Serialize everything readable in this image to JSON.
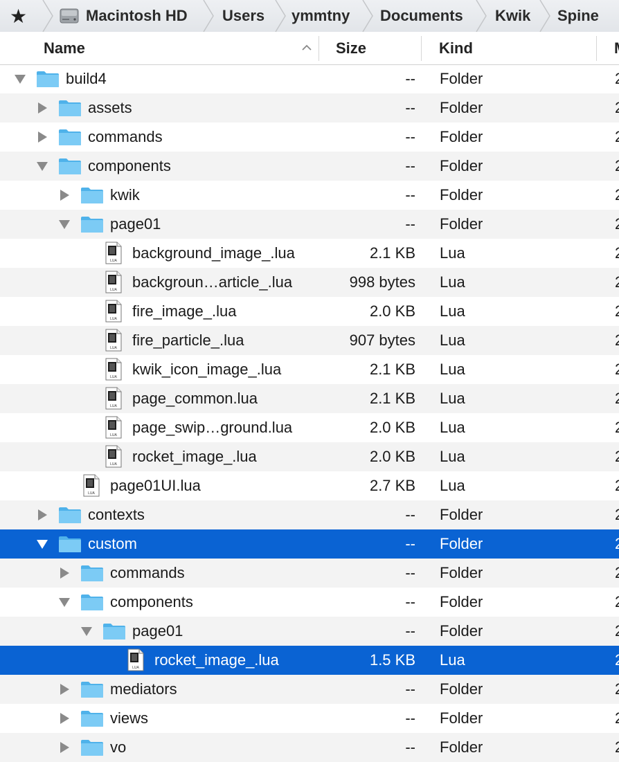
{
  "pathbar": {
    "star_label": "★",
    "crumbs": [
      "Macintosh HD",
      "Users",
      "ymmtny",
      "Documents",
      "Kwik",
      "Spine"
    ]
  },
  "header": {
    "name_label": "Name",
    "size_label": "Size",
    "kind_label": "Kind",
    "date_label": "M"
  },
  "rows": [
    {
      "name": "build4",
      "size": "--",
      "kind": "Folder",
      "date": "2",
      "type": "folder",
      "depth": 0,
      "disclosure": "open"
    },
    {
      "name": "assets",
      "size": "--",
      "kind": "Folder",
      "date": "2",
      "type": "folder",
      "depth": 1,
      "disclosure": "closed"
    },
    {
      "name": "commands",
      "size": "--",
      "kind": "Folder",
      "date": "2",
      "type": "folder",
      "depth": 1,
      "disclosure": "closed"
    },
    {
      "name": "components",
      "size": "--",
      "kind": "Folder",
      "date": "2",
      "type": "folder",
      "depth": 1,
      "disclosure": "open"
    },
    {
      "name": "kwik",
      "size": "--",
      "kind": "Folder",
      "date": "2",
      "type": "folder",
      "depth": 2,
      "disclosure": "closed"
    },
    {
      "name": "page01",
      "size": "--",
      "kind": "Folder",
      "date": "2",
      "type": "folder",
      "depth": 2,
      "disclosure": "open"
    },
    {
      "name": "background_image_.lua",
      "size": "2.1 KB",
      "kind": "Lua",
      "date": "2",
      "type": "file",
      "depth": 3
    },
    {
      "name": "backgroun…article_.lua",
      "size": "998 bytes",
      "kind": "Lua",
      "date": "2",
      "type": "file",
      "depth": 3
    },
    {
      "name": "fire_image_.lua",
      "size": "2.0 KB",
      "kind": "Lua",
      "date": "2",
      "type": "file",
      "depth": 3
    },
    {
      "name": "fire_particle_.lua",
      "size": "907 bytes",
      "kind": "Lua",
      "date": "2",
      "type": "file",
      "depth": 3
    },
    {
      "name": "kwik_icon_image_.lua",
      "size": "2.1 KB",
      "kind": "Lua",
      "date": "2",
      "type": "file",
      "depth": 3
    },
    {
      "name": "page_common.lua",
      "size": "2.1 KB",
      "kind": "Lua",
      "date": "2",
      "type": "file",
      "depth": 3
    },
    {
      "name": "page_swip…ground.lua",
      "size": "2.0 KB",
      "kind": "Lua",
      "date": "2",
      "type": "file",
      "depth": 3
    },
    {
      "name": "rocket_image_.lua",
      "size": "2.0 KB",
      "kind": "Lua",
      "date": "2",
      "type": "file",
      "depth": 3
    },
    {
      "name": "page01UI.lua",
      "size": "2.7 KB",
      "kind": "Lua",
      "date": "2",
      "type": "file",
      "depth": 2
    },
    {
      "name": "contexts",
      "size": "--",
      "kind": "Folder",
      "date": "2",
      "type": "folder",
      "depth": 1,
      "disclosure": "closed"
    },
    {
      "name": "custom",
      "size": "--",
      "kind": "Folder",
      "date": "2",
      "type": "folder",
      "depth": 1,
      "disclosure": "open",
      "selected": true
    },
    {
      "name": "commands",
      "size": "--",
      "kind": "Folder",
      "date": "2",
      "type": "folder",
      "depth": 2,
      "disclosure": "closed"
    },
    {
      "name": "components",
      "size": "--",
      "kind": "Folder",
      "date": "2",
      "type": "folder",
      "depth": 2,
      "disclosure": "open"
    },
    {
      "name": "page01",
      "size": "--",
      "kind": "Folder",
      "date": "2",
      "type": "folder",
      "depth": 3,
      "disclosure": "open"
    },
    {
      "name": "rocket_image_.lua",
      "size": "1.5 KB",
      "kind": "Lua",
      "date": "2",
      "type": "file",
      "depth": 4,
      "selected": true
    },
    {
      "name": "mediators",
      "size": "--",
      "kind": "Folder",
      "date": "2",
      "type": "folder",
      "depth": 2,
      "disclosure": "closed"
    },
    {
      "name": "views",
      "size": "--",
      "kind": "Folder",
      "date": "2",
      "type": "folder",
      "depth": 2,
      "disclosure": "closed"
    },
    {
      "name": "vo",
      "size": "--",
      "kind": "Folder",
      "date": "2",
      "type": "folder",
      "depth": 2,
      "disclosure": "closed"
    }
  ],
  "colors": {
    "selection": "#0a63d3",
    "folder": "#5fbff2",
    "stripe": "#f3f3f3"
  }
}
